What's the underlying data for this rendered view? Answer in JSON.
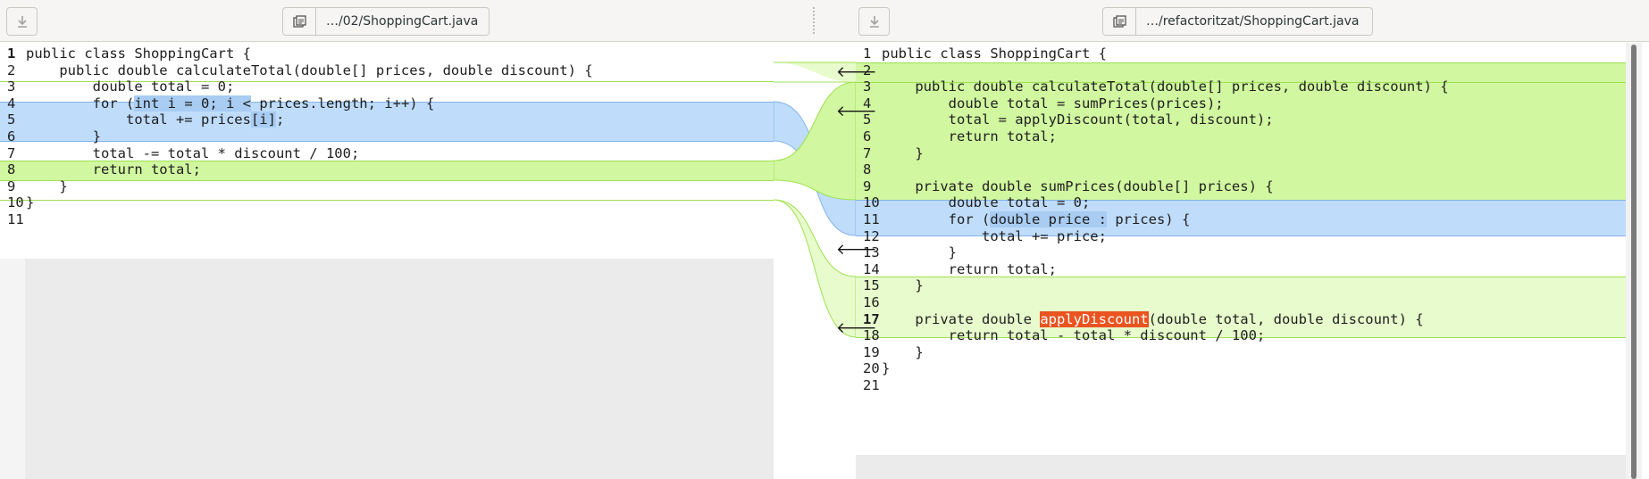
{
  "toolbar": {
    "left_file": "…/02/ShoppingCart.java",
    "right_file": "…/refactoritzat/ShoppingCart.java"
  },
  "left_lines": [
    {
      "n": "1",
      "text": "public class ShoppingCart {",
      "bold": true
    },
    {
      "n": "2",
      "text": "    public double calculateTotal(double[] prices, double discount) {"
    },
    {
      "n": "3",
      "text": "        double total = 0;"
    },
    {
      "n": "4",
      "text": "        for (int i = 0; i < prices.length; i++) {"
    },
    {
      "n": "5",
      "text": "            total += prices[i];"
    },
    {
      "n": "6",
      "text": "        }"
    },
    {
      "n": "7",
      "text": "        total -= total * discount / 100;"
    },
    {
      "n": "8",
      "text": "        return total;"
    },
    {
      "n": "9",
      "text": "    }"
    },
    {
      "n": "10",
      "text": "}"
    },
    {
      "n": "11",
      "text": ""
    }
  ],
  "right_lines": [
    {
      "n": "1",
      "text": "public class ShoppingCart {"
    },
    {
      "n": "2",
      "text": ""
    },
    {
      "n": "3",
      "text": "    public double calculateTotal(double[] prices, double discount) {"
    },
    {
      "n": "4",
      "text": "        double total = sumPrices(prices);"
    },
    {
      "n": "5",
      "text": "        total = applyDiscount(total, discount);"
    },
    {
      "n": "6",
      "text": "        return total;"
    },
    {
      "n": "7",
      "text": "    }"
    },
    {
      "n": "8",
      "text": ""
    },
    {
      "n": "9",
      "text": "    private double sumPrices(double[] prices) {"
    },
    {
      "n": "10",
      "text": "        double total = 0;"
    },
    {
      "n": "11",
      "text": "        for (double price : prices) {"
    },
    {
      "n": "12",
      "text": "            total += price;"
    },
    {
      "n": "13",
      "text": "        }"
    },
    {
      "n": "14",
      "text": "        return total;"
    },
    {
      "n": "15",
      "text": "    }"
    },
    {
      "n": "16",
      "text": ""
    },
    {
      "n": "17",
      "text": "    private double applyDiscount(double total, double discount) {",
      "bold": true
    },
    {
      "n": "18",
      "text": "        return total - total * discount / 100;"
    },
    {
      "n": "19",
      "text": "    }"
    },
    {
      "n": "20",
      "text": "}"
    },
    {
      "n": "21",
      "text": ""
    }
  ],
  "colors": {
    "insert": "#d1f7a0",
    "change": "#bfdcfb",
    "inline_change": "#a8ccf2",
    "cursor_match": "#e95420"
  },
  "icons": {
    "save": "download-arrow-icon",
    "open": "open-file-icon",
    "push_right": "arrow-right-icon",
    "push_left": "arrow-left-icon"
  }
}
